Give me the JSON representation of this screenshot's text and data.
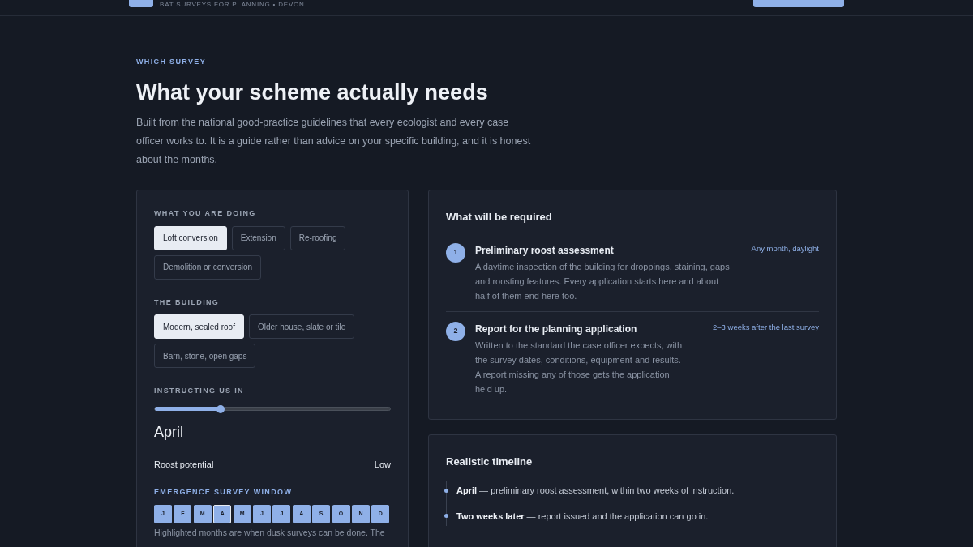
{
  "header": {
    "subtitle": "BAT SURVEYS FOR PLANNING • DEVON"
  },
  "intro": {
    "eyebrow": "WHICH SURVEY",
    "title": "What your scheme actually needs",
    "text": "Built from the national good-practice guidelines that every ecologist and every case officer works to. It is a guide rather than advice on your specific building, and it is honest about the months."
  },
  "form": {
    "doing": {
      "label": "WHAT YOU ARE DOING",
      "options": [
        {
          "label": "Loft conversion",
          "selected": true
        },
        {
          "label": "Extension",
          "selected": false
        },
        {
          "label": "Re-roofing",
          "selected": false
        },
        {
          "label": "Demolition or conversion",
          "selected": false
        }
      ]
    },
    "building": {
      "label": "THE BUILDING",
      "options": [
        {
          "label": "Modern, sealed roof",
          "selected": true
        },
        {
          "label": "Older house, slate or tile",
          "selected": false
        },
        {
          "label": "Barn, stone, open gaps",
          "selected": false
        }
      ]
    },
    "month": {
      "label": "INSTRUCTING US IN",
      "level": 0.28,
      "value": "April"
    },
    "roost": {
      "label": "Roost potential",
      "value": "Low"
    },
    "window": {
      "label": "EMERGENCE SURVEY WINDOW",
      "months": [
        {
          "label": "J",
          "highlighted": true,
          "selected": false
        },
        {
          "label": "F",
          "highlighted": true,
          "selected": false
        },
        {
          "label": "M",
          "highlighted": true,
          "selected": false
        },
        {
          "label": "A",
          "highlighted": true,
          "selected": true
        },
        {
          "label": "M",
          "highlighted": true,
          "selected": false
        },
        {
          "label": "J",
          "highlighted": true,
          "selected": false
        },
        {
          "label": "J",
          "highlighted": true,
          "selected": false
        },
        {
          "label": "A",
          "highlighted": true,
          "selected": false
        },
        {
          "label": "S",
          "highlighted": true,
          "selected": false
        },
        {
          "label": "O",
          "highlighted": true,
          "selected": false
        },
        {
          "label": "N",
          "highlighted": true,
          "selected": false
        },
        {
          "label": "D",
          "highlighted": true,
          "selected": false
        }
      ],
      "note": "Highlighted months are when dusk surveys can be done. The"
    }
  },
  "required": {
    "title": "What will be required",
    "steps": [
      {
        "number": "1",
        "title": "Preliminary roost assessment",
        "timing": "Any month, daylight",
        "text": "A daytime inspection of the building for droppings, staining, gaps and roosting features. Every application starts here and about half of them end here too."
      },
      {
        "number": "2",
        "title": "Report for the planning application",
        "timing": "2–3 weeks after the last survey",
        "text": "Written to the standard the case officer expects, with the survey dates, conditions, equipment and results. A report missing any of those gets the application held up."
      }
    ]
  },
  "timeline": {
    "title": "Realistic timeline",
    "entries": [
      "**April** — preliminary roost assessment, within two weeks of instruction.",
      "**Two weeks later** — report issued and the application can go in."
    ]
  }
}
